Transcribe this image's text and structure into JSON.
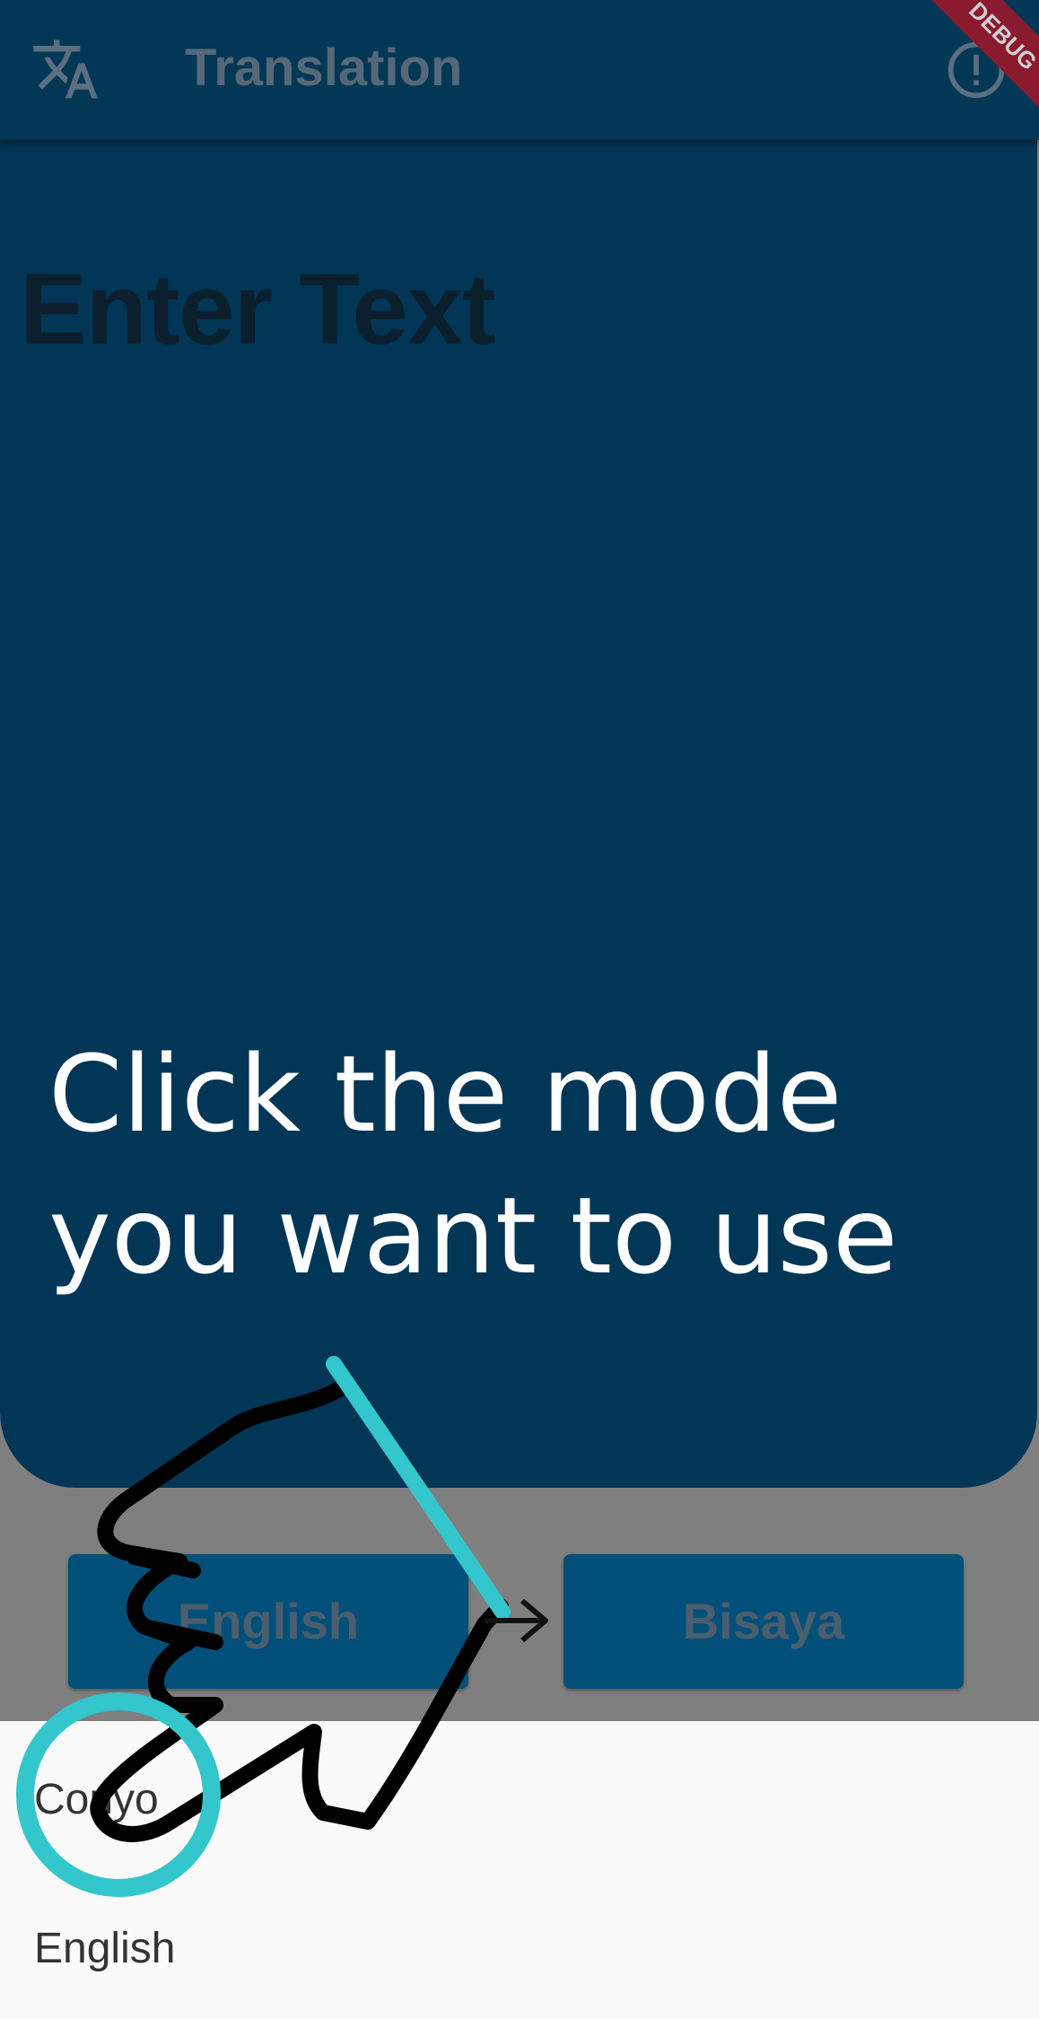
{
  "appbar": {
    "title": "Translation",
    "leading_icon": "translate-icon",
    "trailing_icon": "info-icon",
    "debug_banner": "DEBUG"
  },
  "input_panel": {
    "placeholder": "Enter Text"
  },
  "tutorial": {
    "instruction_line1": "Click the mode",
    "instruction_line2": "you want to use",
    "gesture_icon": "pointing-hand-icon"
  },
  "language_selector": {
    "source_label": "English",
    "target_label": "Bisaya",
    "swap_icon": "arrow-right-icon"
  },
  "mode_sheet": {
    "options": [
      "Conyo",
      "English"
    ]
  },
  "colors": {
    "appbar": "#023855",
    "panel": "#013656",
    "button": "#02507a",
    "highlight": "#33c6cc"
  }
}
